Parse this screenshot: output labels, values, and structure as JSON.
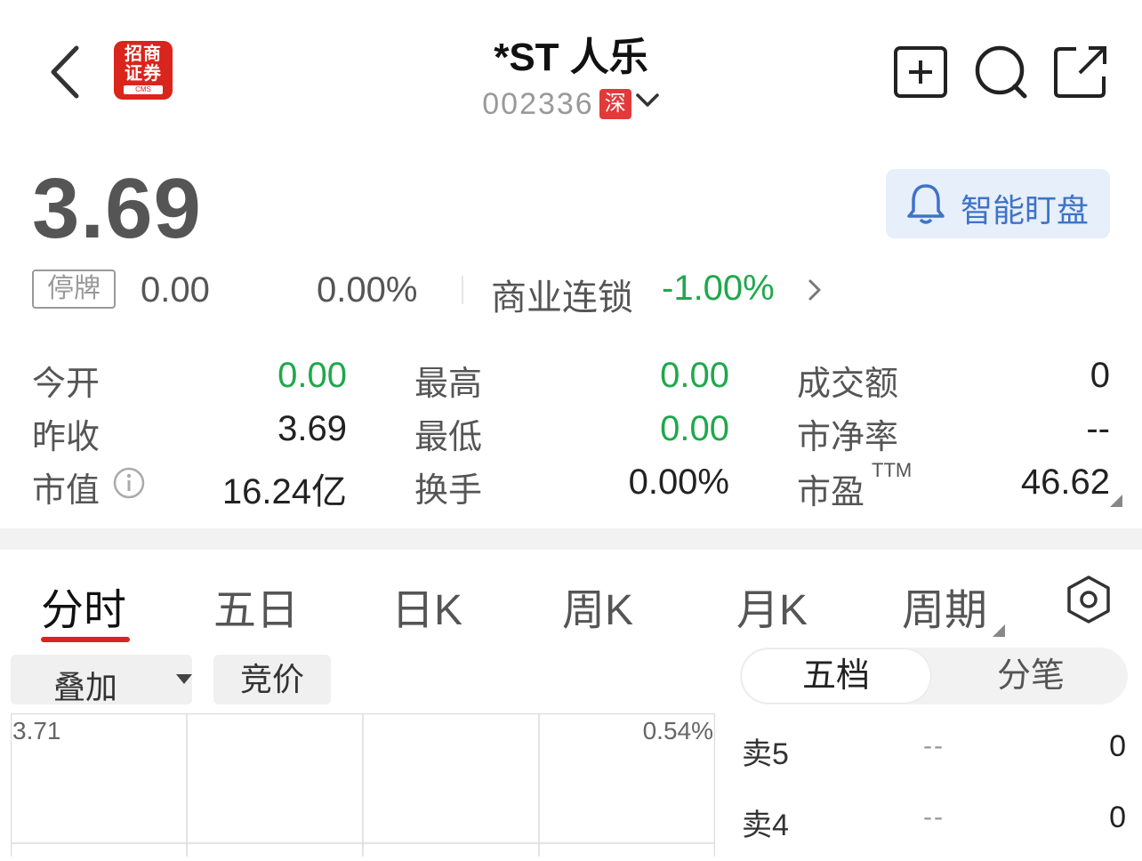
{
  "header": {
    "logo": {
      "line1": "招商",
      "line2": "证券",
      "line3": "CMS"
    },
    "title": "*ST 人乐",
    "code": "002336",
    "market": "深"
  },
  "quote": {
    "price": "3.69",
    "status": "停牌",
    "change": "0.00",
    "change_pct": "0.00%",
    "sector": "商业连锁",
    "sector_pct": "-1.00%",
    "alert_label": "智能盯盘"
  },
  "stats": {
    "open": {
      "label": "今开",
      "value": "0.00"
    },
    "prev_close": {
      "label": "昨收",
      "value": "3.69"
    },
    "mkt_cap": {
      "label": "市值",
      "value": "16.24亿"
    },
    "high": {
      "label": "最高",
      "value": "0.00"
    },
    "low": {
      "label": "最低",
      "value": "0.00"
    },
    "turnover": {
      "label": "换手",
      "value": "0.00%"
    },
    "amount": {
      "label": "成交额",
      "value": "0"
    },
    "pb": {
      "label": "市净率",
      "value": "--"
    },
    "pe": {
      "label": "市盈",
      "suffix": "TTM",
      "value": "46.62"
    }
  },
  "tabs": [
    "分时",
    "五日",
    "日K",
    "周K",
    "月K",
    "周期"
  ],
  "controls": {
    "overlay": "叠加",
    "auction": "竞价"
  },
  "segment": {
    "five": "五档",
    "tick": "分笔"
  },
  "chart": {
    "left_top": "3.71",
    "right_top": "0.54%"
  },
  "order_book": [
    {
      "label": "卖5",
      "price": "--",
      "volume": "0"
    },
    {
      "label": "卖4",
      "price": "--",
      "volume": "0"
    }
  ],
  "colors": {
    "up": "#d9251c",
    "down": "#1fa84b",
    "accent": "#3f73c7"
  }
}
